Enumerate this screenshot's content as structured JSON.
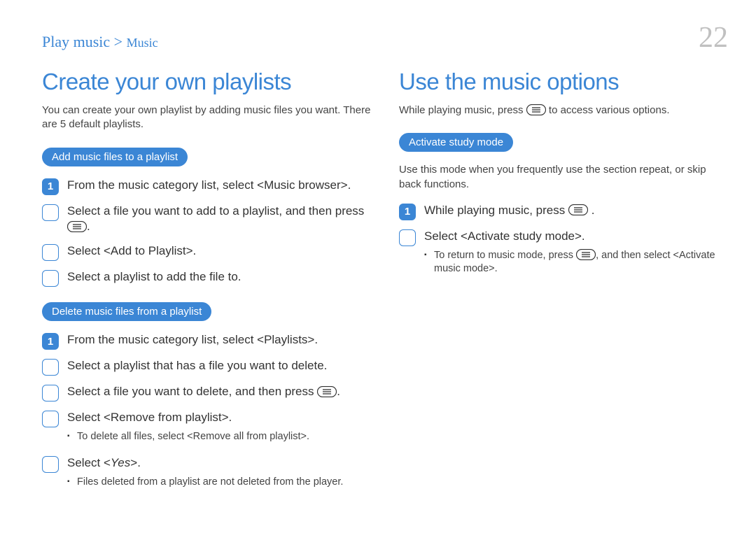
{
  "header": {
    "breadcrumb_main": "Play music",
    "breadcrumb_sep": " > ",
    "breadcrumb_sub": "Music",
    "page_number": "22"
  },
  "left": {
    "heading": "Create your own playlists",
    "intro": "You can create your own playlist by adding music files you want. There are 5 default playlists.",
    "section1": {
      "pill": "Add music files to a playlist",
      "steps": [
        {
          "num": "1",
          "filled": true,
          "text": "From the music category list, select <Music browser>."
        },
        {
          "num": "",
          "filled": false,
          "text_pre": "Select a file you want to add to a playlist, and then press ",
          "has_icon": true,
          "text_post": "."
        },
        {
          "num": "",
          "filled": false,
          "text": "Select <Add to Playlist>."
        },
        {
          "num": "",
          "filled": false,
          "text": "Select a playlist to add the file to."
        }
      ]
    },
    "section2": {
      "pill": "Delete music files from a playlist",
      "steps": [
        {
          "num": "1",
          "filled": true,
          "text": "From the music category list, select <Playlists>."
        },
        {
          "num": "",
          "filled": false,
          "text": "Select a playlist that has a file you want to delete."
        },
        {
          "num": "",
          "filled": false,
          "text_pre": "Select a file you want to delete, and then press ",
          "has_icon": true,
          "text_post": "."
        },
        {
          "num": "",
          "filled": false,
          "text": "Select <Remove from playlist>.",
          "bullets": [
            "To delete all files, select <Remove all from playlist>."
          ]
        },
        {
          "num": "",
          "filled": false,
          "text_html_pre": "Select <",
          "text_italic": "Yes",
          "text_html_post": ">.",
          "bullets": [
            "Files deleted from a playlist are not deleted from the player."
          ]
        }
      ]
    }
  },
  "right": {
    "heading": "Use the music options",
    "intro_pre": "While playing music, press ",
    "intro_post": " to access various options.",
    "section1": {
      "pill": "Activate study mode",
      "desc": "Use this mode when you frequently use the section repeat, or skip back functions.",
      "steps": [
        {
          "num": "1",
          "filled": true,
          "text_pre": "While playing music, press ",
          "has_icon": true,
          "text_post": " ."
        },
        {
          "num": "",
          "filled": false,
          "text": "Select <Activate study mode>.",
          "bullets_icon": [
            {
              "pre": "To return to music mode, press ",
              "post": ", and then select <Activate music mode>."
            }
          ]
        }
      ]
    }
  }
}
